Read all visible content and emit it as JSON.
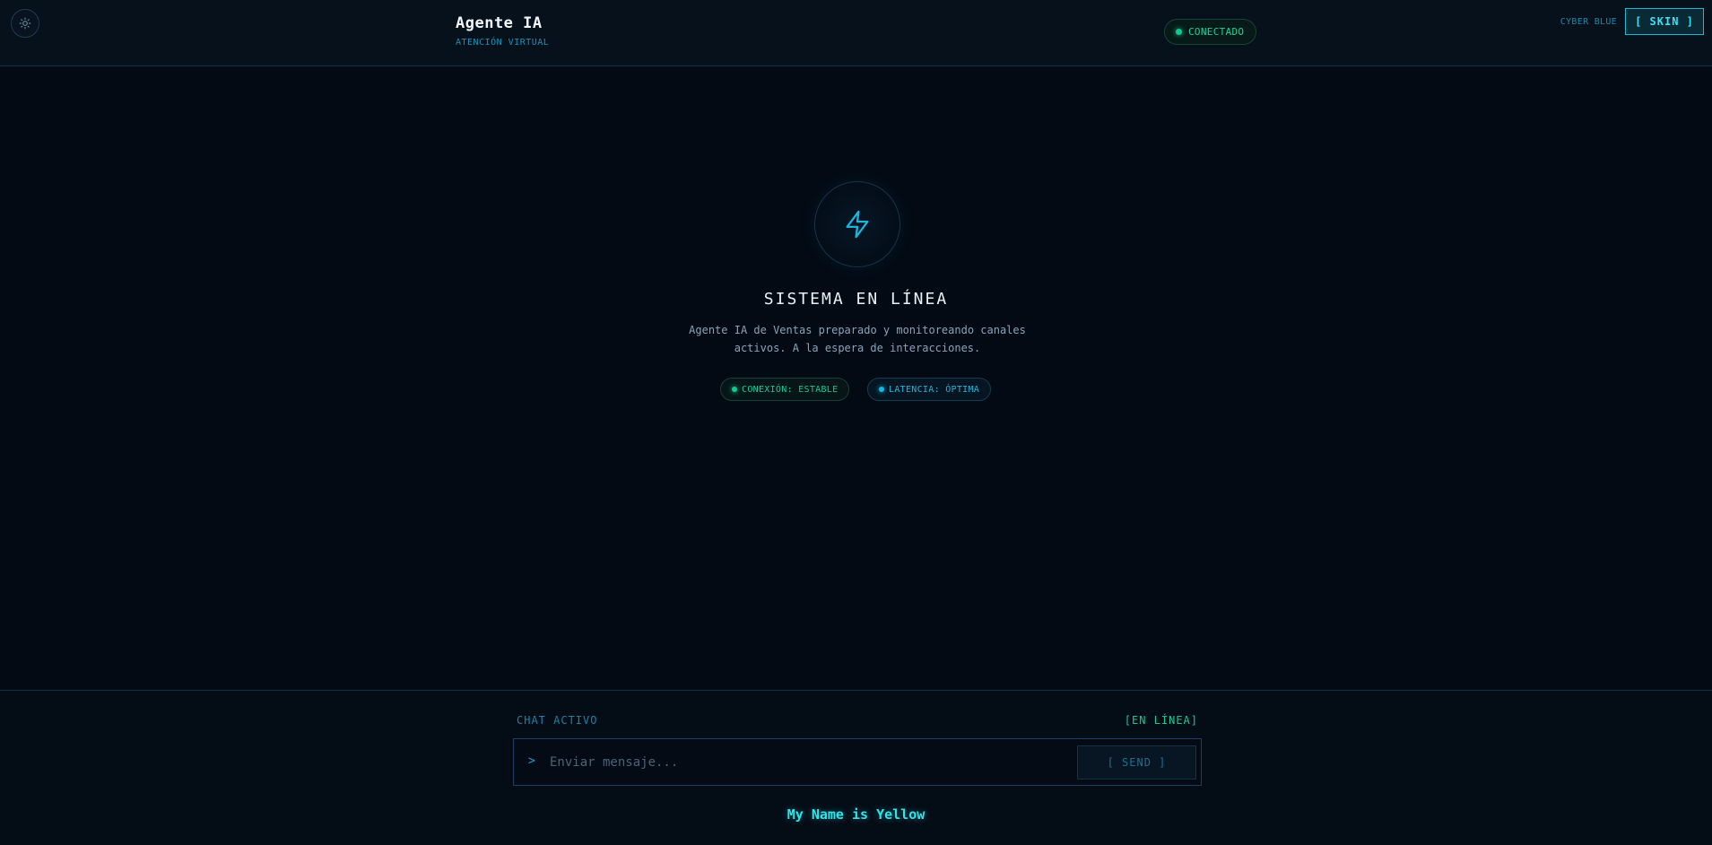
{
  "header": {
    "title": "Agente IA",
    "subtitle": "ATENCIÓN VIRTUAL",
    "status": "CONECTADO",
    "skin_name": "CYBER BLUE",
    "skin_button": "[ SKIN ]",
    "theme_icon": "sun-icon"
  },
  "hero": {
    "icon": "lightning-icon",
    "title": "SISTEMA EN LÍNEA",
    "description_line1": "Agente IA de Ventas preparado y monitoreando canales",
    "description_line2": "activos. A la espera de interacciones.",
    "chips": [
      {
        "label": "CONEXIÓN: ESTABLE",
        "color": "#18c995"
      },
      {
        "label": "LATENCIA: ÓPTIMA",
        "color": "#1fb4dc"
      }
    ]
  },
  "chat": {
    "label": "CHAT ACTIVO",
    "status": "[EN LÍNEA]",
    "prompt": ">",
    "input_placeholder": "Enviar mensaje...",
    "input_value": "",
    "send_label": "[ SEND ]"
  },
  "footer": {
    "name": "My Name is Yellow"
  },
  "colors": {
    "background": "#030a14",
    "accent_cyan": "#1fb4dc",
    "accent_green": "#18c995",
    "footer_text": "#2fe4ea"
  }
}
